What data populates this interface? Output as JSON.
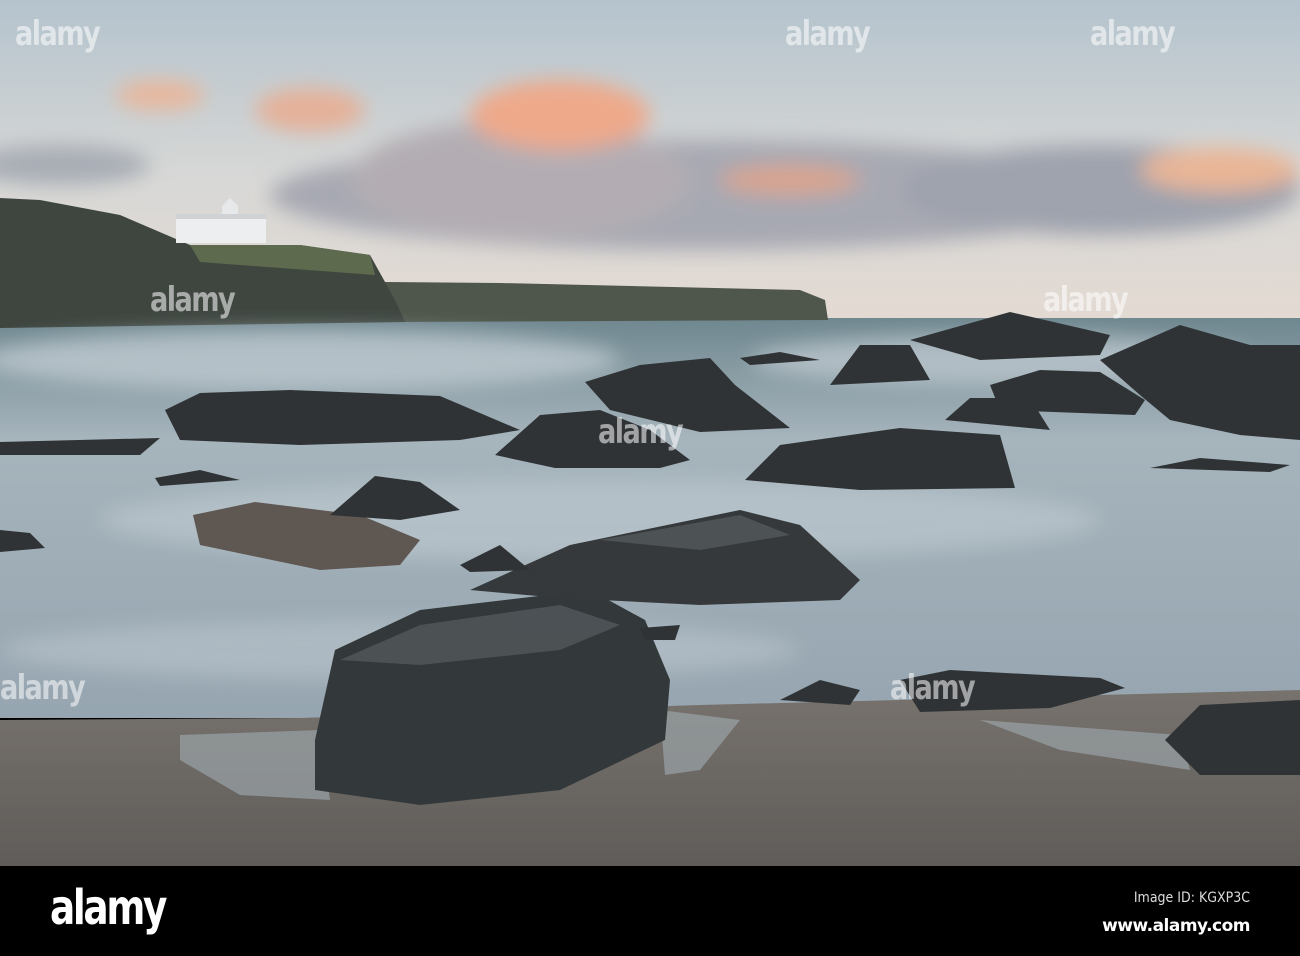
{
  "photo": {
    "subject": "seascape",
    "colors": {
      "sky_top": "#b4c3cd",
      "sky_horizon": "#e6d8cc",
      "sea": "#8b9ca7",
      "sand": "#6a6662",
      "rock": "#2e3234",
      "cloud_pink": "#e8a88a"
    }
  },
  "watermark": {
    "text": "alamy"
  },
  "footer": {
    "logo": "alamy",
    "image_id": "Image ID: KGXP3C",
    "website": "www.alamy.com"
  }
}
